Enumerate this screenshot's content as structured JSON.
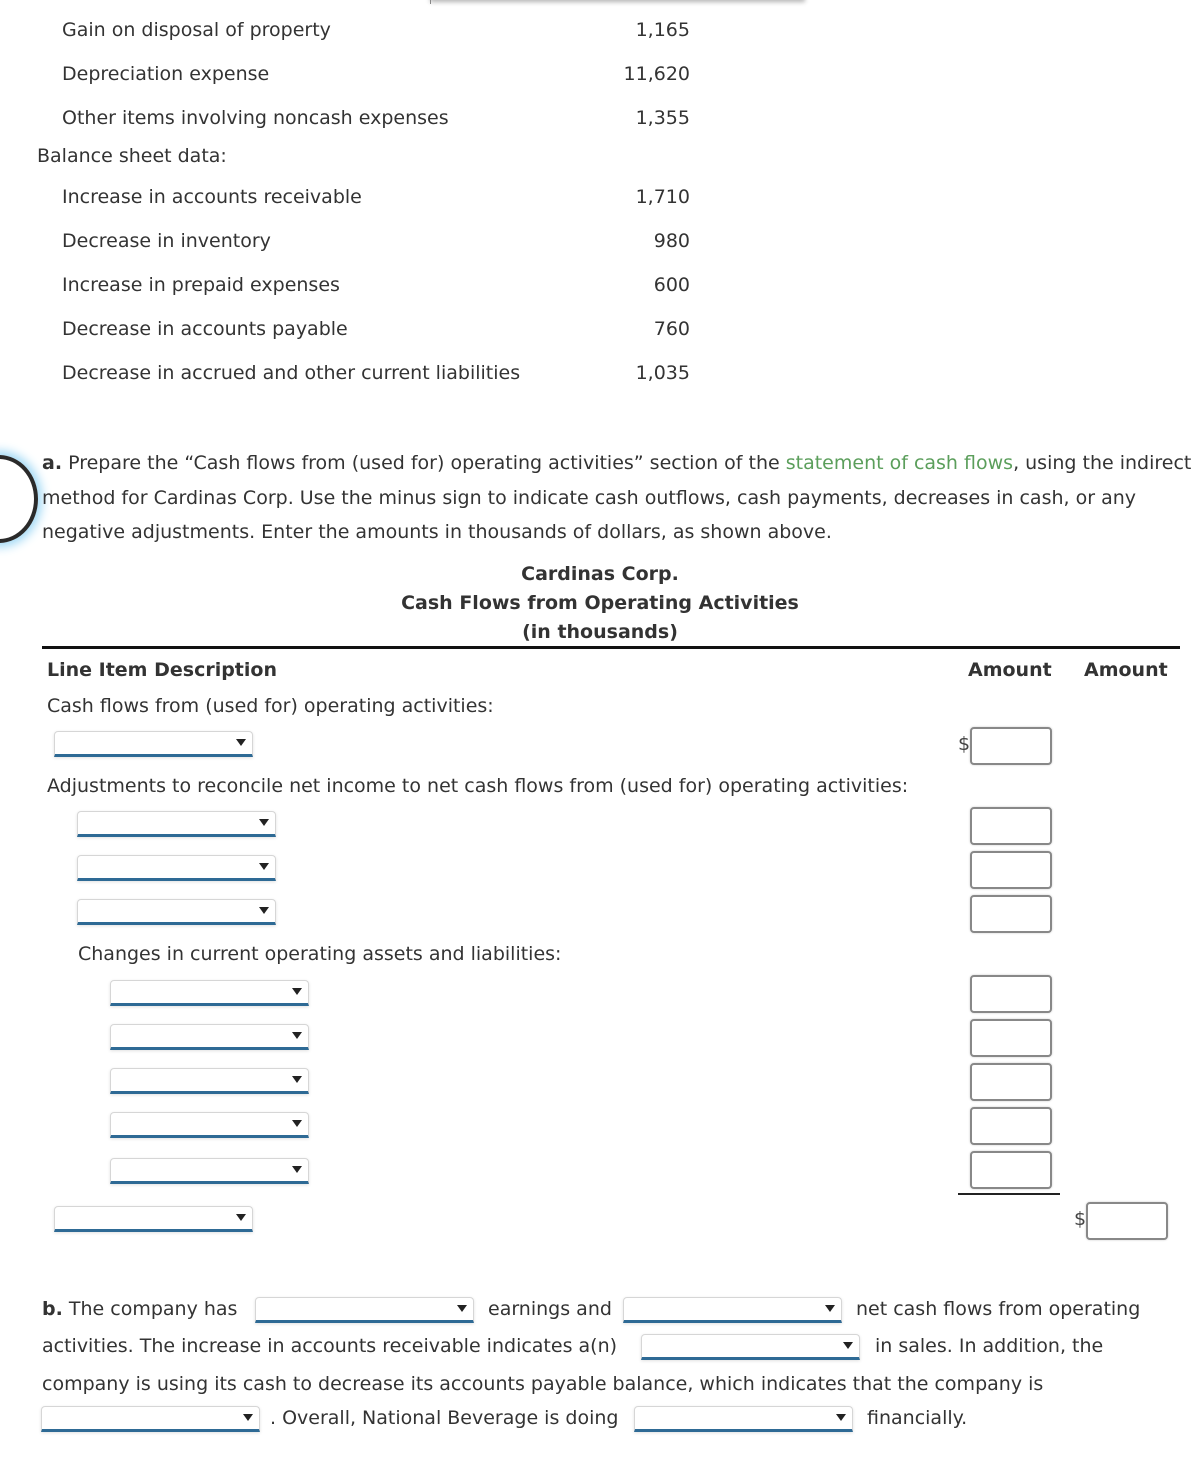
{
  "given_data": {
    "income_items": [
      {
        "label": "Gain on disposal of property",
        "value": "1,165"
      },
      {
        "label": "Depreciation expense",
        "value": "11,620"
      },
      {
        "label": "Other items involving noncash expenses",
        "value": "1,355"
      }
    ],
    "balance_sheet_heading": "Balance sheet data:",
    "balance_items": [
      {
        "label": "Increase in accounts receivable",
        "value": "1,710"
      },
      {
        "label": "Decrease in inventory",
        "value": "980"
      },
      {
        "label": "Increase in prepaid expenses",
        "value": "600"
      },
      {
        "label": "Decrease in accounts payable",
        "value": "760"
      },
      {
        "label": "Decrease in accrued and other current liabilities",
        "value": "1,035"
      }
    ]
  },
  "part_a": {
    "marker": "a.",
    "text_1": " Prepare the “Cash flows from (used for) operating activities” section of the ",
    "link": "statement of cash flows",
    "text_2": ", using the indirect method for Cardinas Corp. Use the minus sign to indicate cash outflows, cash payments, decreases in cash, or any negative adjustments. Enter the amounts in thousands of dollars, as shown above."
  },
  "statement": {
    "company": "Cardinas Corp.",
    "title": "Cash Flows from Operating Activities",
    "units": "(in thousands)",
    "col_description": "Line Item Description",
    "col_amount_1": "Amount",
    "col_amount_2": "Amount",
    "section_operating": "Cash flows from (used for) operating activities:",
    "section_adjustments": "Adjustments to reconcile net income to net cash flows from (used for) operating activities:",
    "section_changes": "Changes in current operating assets and liabilities:",
    "currency_symbol": "$"
  },
  "part_b": {
    "marker": "b.",
    "t1": " The company has ",
    "t2": "earnings and",
    "t3": "net cash flows from operating",
    "t4": "activities. The increase in accounts receivable indicates a(n)",
    "t5": "in sales. In addition, the",
    "t6": "company is using its cash to decrease its accounts payable balance, which indicates that the company is",
    "t7": ". Overall, National Beverage is doing",
    "t8": "financially."
  }
}
